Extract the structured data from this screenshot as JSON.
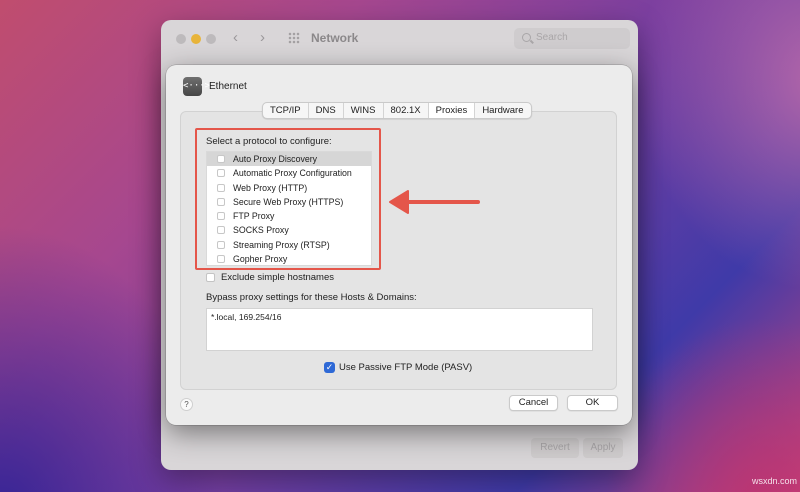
{
  "background_window": {
    "title": "Network",
    "search_placeholder": "Search",
    "revert_label": "Revert",
    "apply_label": "Apply"
  },
  "dialog": {
    "interface_name": "Ethernet",
    "interface_icon_glyph": "<···>",
    "tabs": [
      {
        "label": "TCP/IP",
        "active": false
      },
      {
        "label": "DNS",
        "active": false
      },
      {
        "label": "WINS",
        "active": false
      },
      {
        "label": "802.1X",
        "active": false
      },
      {
        "label": "Proxies",
        "active": true
      },
      {
        "label": "Hardware",
        "active": false
      }
    ],
    "protocol_prompt": "Select a protocol to configure:",
    "protocols": [
      {
        "label": "Auto Proxy Discovery",
        "checked": false,
        "selected": true
      },
      {
        "label": "Automatic Proxy Configuration",
        "checked": false,
        "selected": false
      },
      {
        "label": "Web Proxy (HTTP)",
        "checked": false,
        "selected": false
      },
      {
        "label": "Secure Web Proxy (HTTPS)",
        "checked": false,
        "selected": false
      },
      {
        "label": "FTP Proxy",
        "checked": false,
        "selected": false
      },
      {
        "label": "SOCKS Proxy",
        "checked": false,
        "selected": false
      },
      {
        "label": "Streaming Proxy (RTSP)",
        "checked": false,
        "selected": false
      },
      {
        "label": "Gopher Proxy",
        "checked": false,
        "selected": false
      }
    ],
    "exclude_simple_hostnames": {
      "label": "Exclude simple hostnames",
      "checked": false
    },
    "bypass_label": "Bypass proxy settings for these Hosts & Domains:",
    "bypass_value": "*.local, 169.254/16",
    "passive_ftp": {
      "label": "Use Passive FTP Mode (PASV)",
      "checked": true,
      "check_glyph": "✓"
    },
    "help_label": "?",
    "cancel_label": "Cancel",
    "ok_label": "OK"
  },
  "annotation": {
    "highlight_color": "#e4564a"
  },
  "watermark": "wsxdn.com",
  "colors": {
    "accent": "#2e69d6",
    "traffic_yellow": "#e8b43a"
  }
}
